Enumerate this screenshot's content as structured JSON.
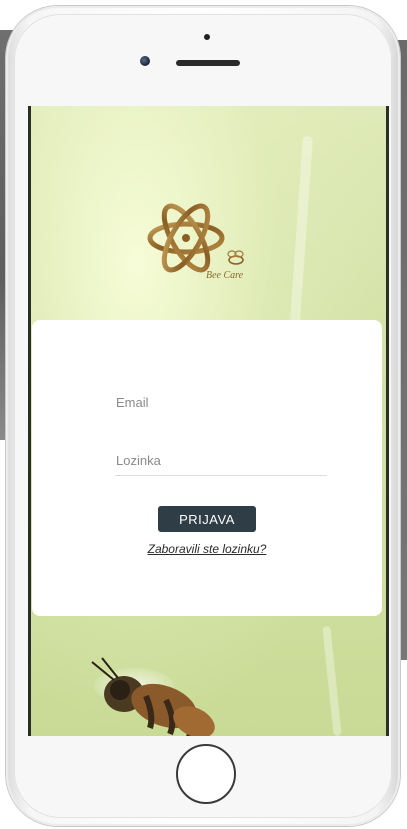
{
  "app": {
    "brand_name": "Bee Care"
  },
  "login_form": {
    "email_placeholder": "Email",
    "password_placeholder": "Lozinka",
    "submit_label": "PRIJAVA",
    "forgot_password_label": "Zaboravili ste lozinku?"
  },
  "colors": {
    "button_bg": "#2f3d46",
    "card_bg": "#ffffff",
    "background_green": "#d3e2a6",
    "logo_gold": "#a57c3a"
  },
  "icons": {
    "logo": "bee-care-logo-icon",
    "background_bee": "bee-icon"
  }
}
